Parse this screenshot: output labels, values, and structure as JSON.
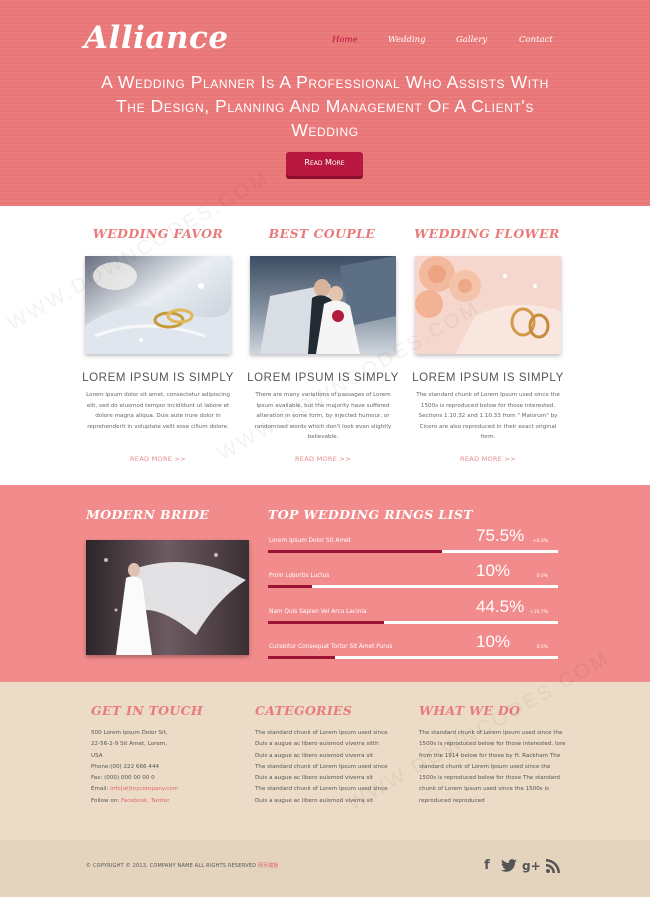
{
  "header": {
    "logo": "Alliance",
    "nav": [
      "Home",
      "Wedding",
      "Gallery",
      "Contact"
    ],
    "active_nav": "Home",
    "hero_text": "A Wedding Planner Is A Professional Who Assists With The Design, Planning And Management Of A Client's Wedding",
    "hero_button": "Read More"
  },
  "features": [
    {
      "title": "Wedding Favor",
      "image_icon": "wedding-rings-on-pillow",
      "heading": "Lorem Ipsum Is Simply",
      "text": "Lorem ipsum dolor sit amet, consectetur adipiscing elit, sed do eiusmod tempor incididunt ut labore et dolore magna aliqua. Duis aute irure dolor in reprehenderit in voluptate velit esse cillum dolore.",
      "more": "READ MORE >>"
    },
    {
      "title": "Best Couple",
      "image_icon": "wedding-couple",
      "heading": "Lorem Ipsum Is Simply",
      "text": "There are many variations of passages of Lorem Ipsum available, but the majority have suffered alteration in some form, by injected humour, or randomised words which don't look even slightly believable.",
      "more": "READ MORE >>"
    },
    {
      "title": "Wedding Flower",
      "image_icon": "roses-and-rings",
      "heading": "Lorem Ipsum Is Simply",
      "text": "The standard chunk of Lorem Ipsum used since the 1500s is reproduced below for those interested. Sections 1.10.32 and 1.10.33 from \" Malorum\" by Cicero are also reproduced in their exact original form.",
      "more": "READ MORE >>"
    }
  ],
  "band": {
    "left_title": "Modern Bride",
    "right_title": "Top Wedding Rings List",
    "rings": [
      {
        "label": "Lorem Ipsum Dolor Sit Amet",
        "value": "75.5%",
        "delta": "+6.0%",
        "progress": 0.6
      },
      {
        "label": "Proin Lobortis Luctus",
        "value": "10%",
        "delta": "0.0%",
        "progress": 0.15
      },
      {
        "label": "Nam Quis Sapien Vel Arcu Lacinia",
        "value": "44.5%",
        "delta": "+10.7%",
        "progress": 0.4
      },
      {
        "label": "Curabitur Consequat Tortor Sit Amet Purus",
        "value": "10%",
        "delta": "0.0%",
        "progress": 0.23
      }
    ]
  },
  "footer": {
    "contact_title": "Get In Touch",
    "contact_lines": [
      "500 Lorem Ipsum Dolor Sit,",
      "22-56-2-9 Sit Amet, Lorem,",
      "USA",
      "Phone:(00) 222 666 444",
      "Fax: (000) 000 00 00 0"
    ],
    "email_label": "Email:",
    "email_value": "info[at]mycompany.com",
    "follow_label": "Follow on:",
    "follow_facebook": "Facebook,",
    "follow_twitter": "Twitter",
    "categories_title": "Categories",
    "categories_lines": [
      "The standard chunk of Lorem Ipsum used since",
      "Duis a augue ac libero euismod viverra sitth",
      "Duis a augue ac libero euismod viverra sit",
      "The standard chunk of Lorem Ipsum used since",
      "Duis a augue ac libero euismod viverra sit",
      "The standard chunk of Lorem Ipsum used since",
      "Duis a augue ac libero euismod viverra sit"
    ],
    "what_title": "What We Do",
    "what_text": "The standard chunk of Lorem Ipsum used since the 1500s is reproduced below for those interested. lore from the 1914 below for those by H. Rackham The standard chunk of Lorem Ipsum used since the 1500s is reproduced below for those The standard chunk of Lorem Ipsum used since the 1500s is reproduced reproduced"
  },
  "bottom": {
    "copyright": "© COPYRIGHT © 2013, COMPANY NAME ALL RIGHTS RESERVED",
    "copyright_link": "网页模板",
    "social_icons": [
      "facebook-icon",
      "twitter-icon",
      "google-plus-icon",
      "rss-icon"
    ]
  },
  "watermark": "WWW.DOWNCODES.COM",
  "colors": {
    "header": "#ea7c7d",
    "accent": "#b8183f",
    "band": "#f28b8b",
    "cream": "#ecdcc7",
    "title_pink": "#ea7b7b"
  }
}
